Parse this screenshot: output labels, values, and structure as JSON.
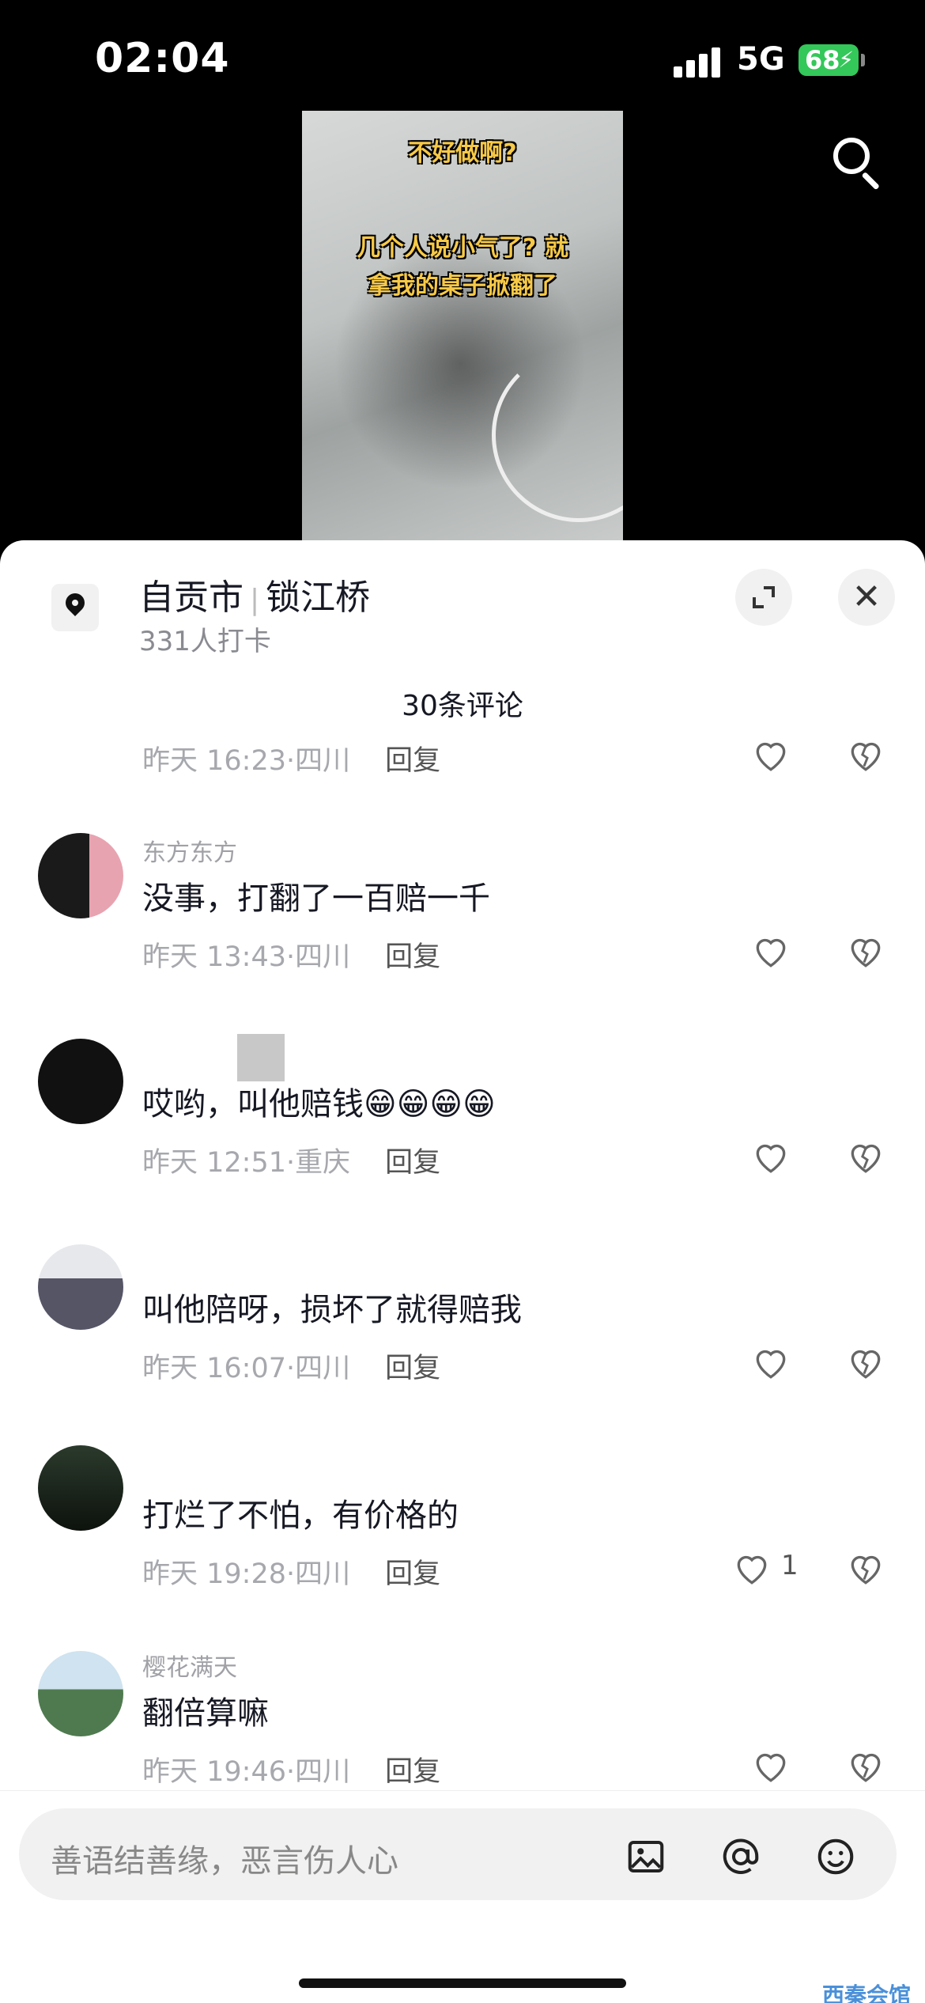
{
  "status": {
    "time": "02:04",
    "network": "5G",
    "battery": "68"
  },
  "video": {
    "caption_top": "不好做啊?",
    "caption_mid_1": "几个人说小气了? 就",
    "caption_mid_2": "拿我的桌子掀翻了"
  },
  "location": {
    "city": "自贡市",
    "place": "锁江桥",
    "checkins": "331人打卡"
  },
  "comments_header": "30条评论",
  "comments": [
    {
      "name": "",
      "text": "",
      "time": "昨天 16:23",
      "region": "四川",
      "reply": "回复",
      "likes": ""
    },
    {
      "name": "东方东方",
      "text": "没事，打翻了一百赔一千",
      "time": "昨天 13:43",
      "region": "四川",
      "reply": "回复",
      "likes": ""
    },
    {
      "name": "",
      "text": "哎哟，叫他赔钱😁😁😁😁",
      "time": "昨天 12:51",
      "region": "重庆",
      "reply": "回复",
      "likes": ""
    },
    {
      "name": "",
      "text": "叫他陪呀，损坏了就得赔我",
      "time": "昨天 16:07",
      "region": "四川",
      "reply": "回复",
      "likes": ""
    },
    {
      "name": "",
      "text": "打烂了不怕，有价格的",
      "time": "昨天 19:28",
      "region": "四川",
      "reply": "回复",
      "likes": "1"
    },
    {
      "name": "樱花满天",
      "text": "翻倍算嘛",
      "time": "昨天 19:46",
      "region": "四川",
      "reply": "回复",
      "likes": ""
    }
  ],
  "input": {
    "placeholder": "善语结善缘，恶言伤人心"
  },
  "watermark": "西秦会馆",
  "colors": {
    "accent_battery": "#34c759",
    "text_primary": "#161823",
    "text_secondary": "#a7a8ad"
  },
  "icons": [
    "search-icon",
    "location-pin-icon",
    "expand-icon",
    "close-icon",
    "heart-icon",
    "dislike-heart-icon",
    "image-icon",
    "at-icon",
    "emoji-icon"
  ]
}
